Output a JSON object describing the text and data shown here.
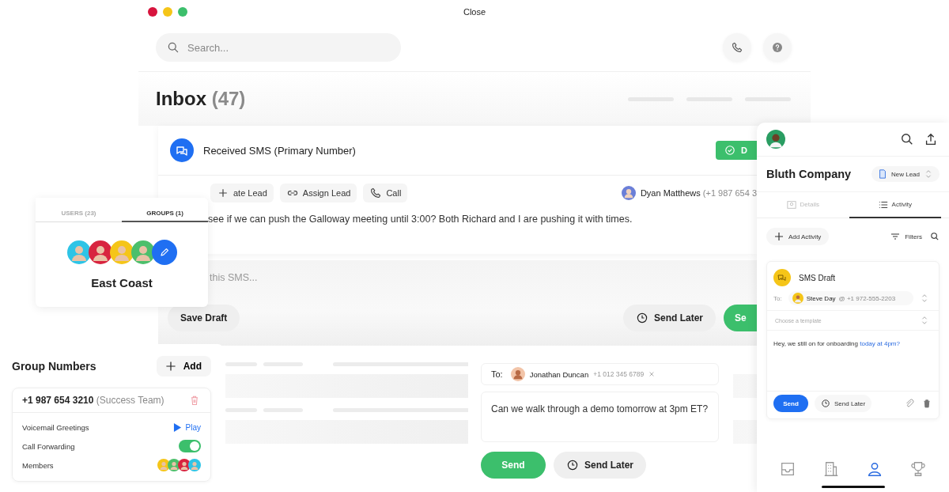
{
  "window": {
    "title": "Close"
  },
  "search": {
    "placeholder": "Search..."
  },
  "inbox": {
    "title": "Inbox",
    "count": "(47)"
  },
  "sms_card": {
    "title": "Received SMS (Primary Number)",
    "status_button": "D",
    "actions": [
      {
        "kind": "create",
        "label": "ate Lead"
      },
      {
        "kind": "assign",
        "label": "Assign Lead"
      },
      {
        "kind": "call",
        "label": "Call"
      }
    ],
    "contact": {
      "name": "Dyan Matthews",
      "phone": "(+1 987 654 3"
    },
    "message": "see if we can push the Galloway meeting until 3:00? Both Richard and I are pushing it with times.",
    "reply_placeholder": "this SMS...",
    "save_draft": "Save Draft",
    "send_later": "Send Later",
    "send": "Se"
  },
  "group_card": {
    "tabs": [
      {
        "label": "USERS (23)",
        "selected": false
      },
      {
        "label": "GROUPS (1)",
        "selected": true
      }
    ],
    "members": [
      {
        "color": "#2ec4e6"
      },
      {
        "color": "#d8243f"
      },
      {
        "color": "#f5c518"
      },
      {
        "color": "#4cbf6b"
      }
    ],
    "name": "East Coast"
  },
  "group_numbers": {
    "title": "Group Numbers",
    "add": "Add",
    "number": "+1 987 654 3210",
    "number_label": "(Success Team)",
    "rows": [
      {
        "kind": "play",
        "label": "Voicemail Greetings",
        "action": "Play"
      },
      {
        "kind": "toggle",
        "label": "Call Forwarding",
        "on": true
      },
      {
        "kind": "members",
        "label": "Members",
        "members": [
          {
            "color": "#f5c518"
          },
          {
            "color": "#4cbf6b"
          },
          {
            "color": "#d8243f"
          },
          {
            "color": "#2ec4e6"
          }
        ]
      }
    ]
  },
  "compose": {
    "to_label": "To:",
    "recipient": "Jonathan Duncan",
    "phone": "+1 012 345 6789",
    "message": "Can we walk through a demo tomorrow at 3pm ET?",
    "send": "Send",
    "send_later": "Send Later"
  },
  "right_panel": {
    "company": "Bluth Company",
    "status": "New Lead",
    "tabs": [
      {
        "label": "Details",
        "selected": false
      },
      {
        "label": "Activity",
        "selected": true
      }
    ],
    "add_activity": "Add Activity",
    "filters": "Filters",
    "draft": {
      "title": "SMS Draft",
      "to_label": "To:",
      "recipient": "Steve Day",
      "phone": "@ +1 972-555-2203",
      "template_placeholder": "Choose a template",
      "message": "Hey, we still on for onboarding",
      "message_link": "today at 4pm?",
      "send": "Send",
      "send_later": "Send Later"
    },
    "nav": [
      {
        "kind": "inbox",
        "selected": false
      },
      {
        "kind": "building",
        "selected": false
      },
      {
        "kind": "person",
        "selected": true
      },
      {
        "kind": "trophy",
        "selected": false
      }
    ]
  }
}
